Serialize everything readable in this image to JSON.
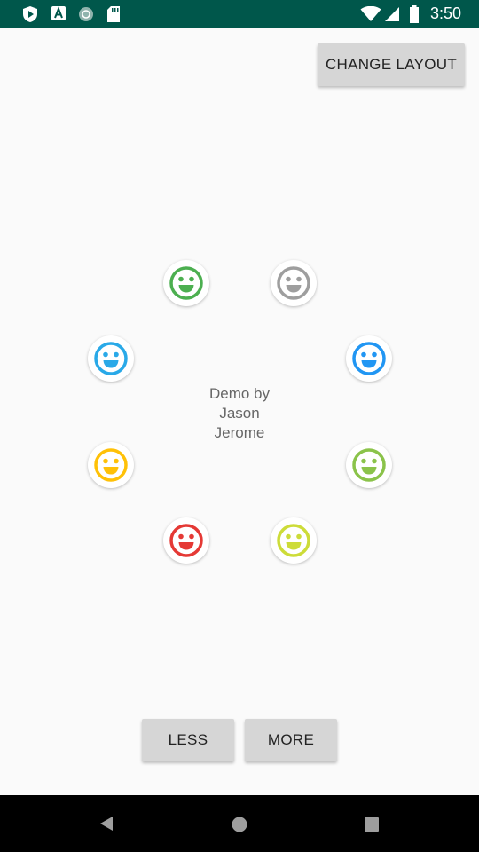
{
  "status_bar": {
    "time": "3:50",
    "icons": [
      "play-protect-icon",
      "app-a-icon",
      "sync-circle-icon",
      "sd-card-icon",
      "wifi-icon",
      "cell-signal-icon",
      "battery-icon"
    ]
  },
  "toolbar": {
    "change_layout_label": "CHANGE LAYOUT"
  },
  "center": {
    "line1": "Demo by",
    "line2": "Jason",
    "line3": "Jerome"
  },
  "smileys": [
    {
      "name": "smiley-green",
      "color": "#4caf50"
    },
    {
      "name": "smiley-gray",
      "color": "#9e9e9e"
    },
    {
      "name": "smiley-blue-left",
      "color": "#29a9e8"
    },
    {
      "name": "smiley-blue-right",
      "color": "#2196f3"
    },
    {
      "name": "smiley-amber",
      "color": "#ffc107"
    },
    {
      "name": "smiley-light-green",
      "color": "#8bc34a"
    },
    {
      "name": "smiley-red",
      "color": "#e53935"
    },
    {
      "name": "smiley-lime",
      "color": "#cddc39"
    }
  ],
  "controls": {
    "less_label": "LESS",
    "more_label": "MORE"
  },
  "nav_bar": {
    "buttons": [
      "back-icon",
      "home-icon",
      "recents-icon"
    ]
  }
}
